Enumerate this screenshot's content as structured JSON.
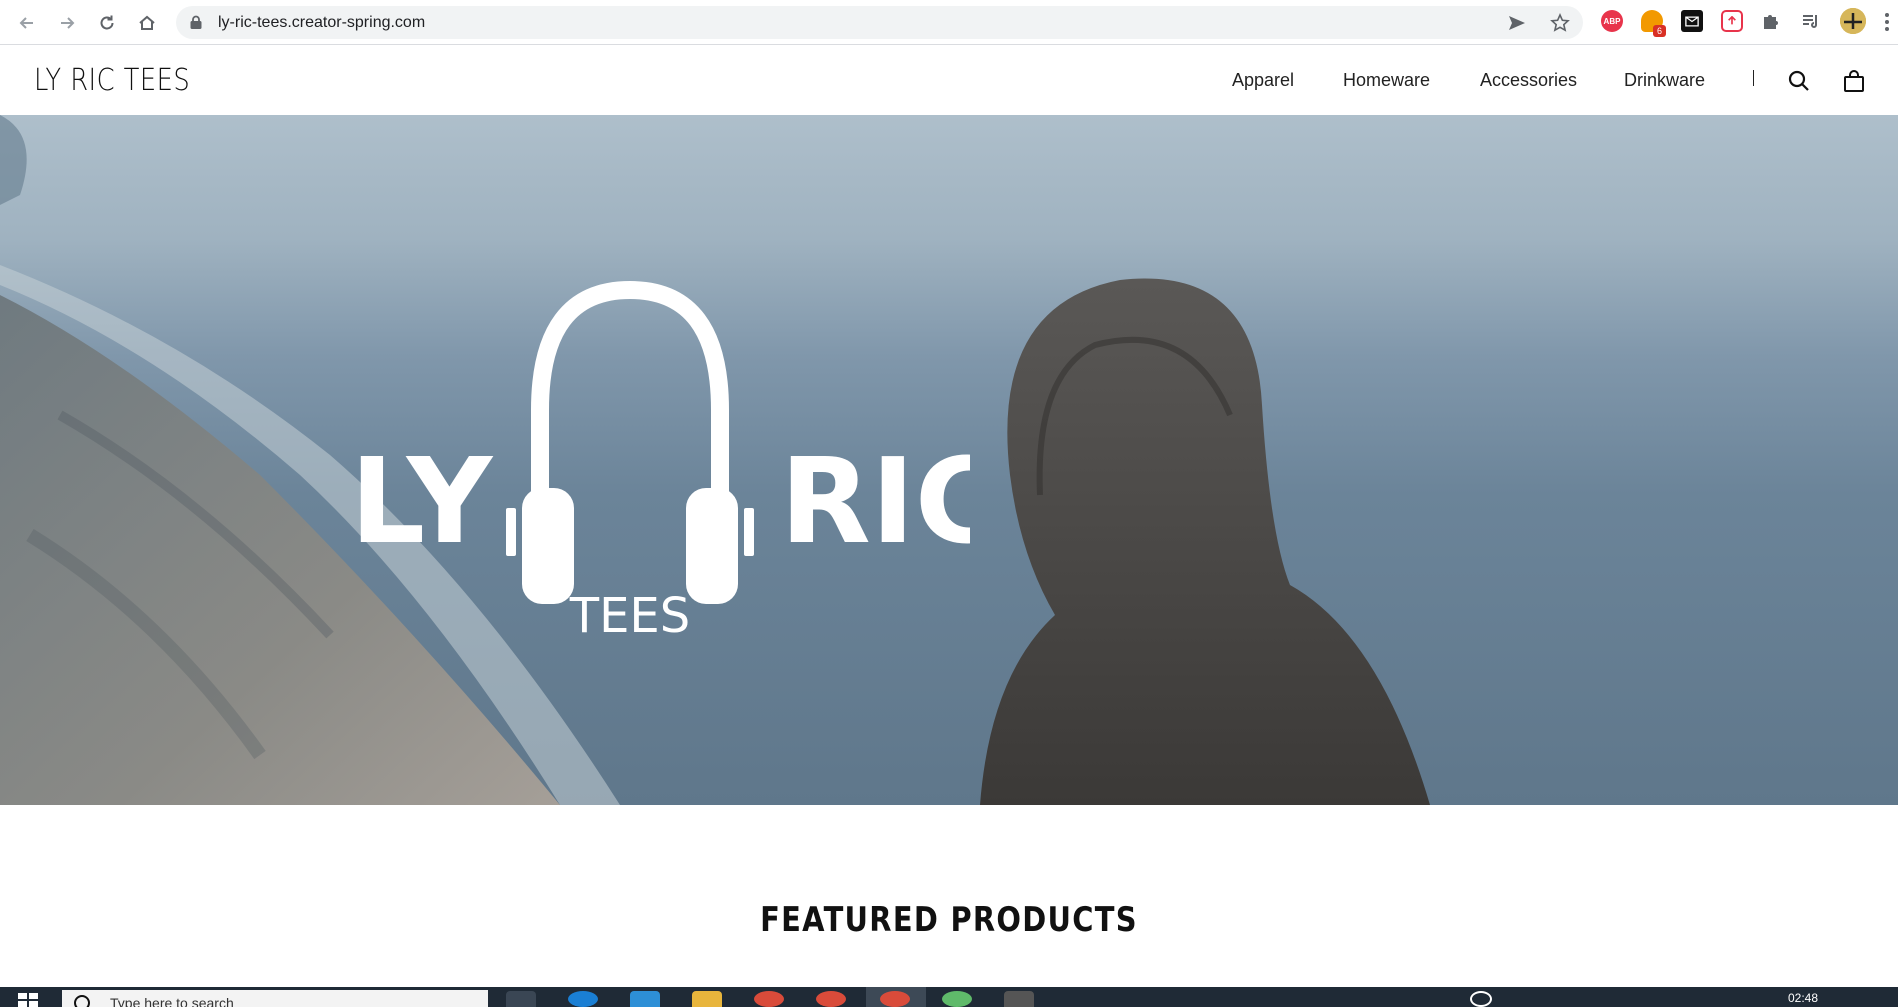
{
  "browser": {
    "url": "ly-ric-tees.creator-spring.com",
    "extension_badge_count": "6",
    "extensions": [
      "abp-extension-icon",
      "extension-6-icon",
      "envelope-extension-icon",
      "upload-extension-icon",
      "puzzle-extension-icon",
      "media-extension-icon",
      "profile-avatar"
    ]
  },
  "site": {
    "brand": "LY RIC TEES",
    "nav": [
      "Apparel",
      "Homeware",
      "Accessories",
      "Drinkware"
    ]
  },
  "hero": {
    "logo_left": "LY",
    "logo_right": "RIC",
    "logo_sub": "TEES"
  },
  "featured": {
    "title": "FEATURED PRODUCTS"
  },
  "taskbar": {
    "search_placeholder": "Type here to search",
    "clock": "02:48"
  },
  "colors": {
    "hero_sky": "#aebfcb",
    "hero_sea": "#6b8499",
    "taskbar": "#1f2a36",
    "omnibox": "#f1f3f4"
  }
}
